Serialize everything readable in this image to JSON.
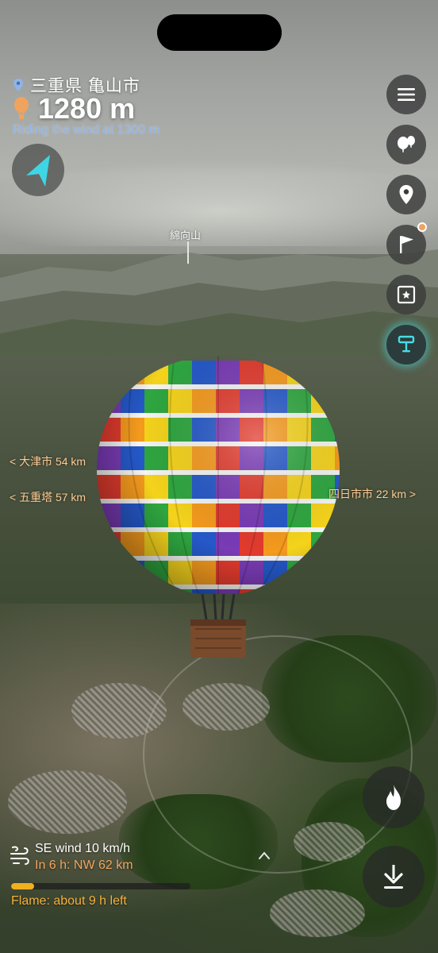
{
  "location": {
    "name": "三重県 亀山市"
  },
  "altitude": {
    "value": "1280 m"
  },
  "status": {
    "riding_text": "Riding the wind at 1300 m"
  },
  "map": {
    "peak_label": "綿向山"
  },
  "directions": {
    "left_1": "< 大津市 54 km",
    "left_2": "< 五重塔 57 km",
    "right_1": "四日市市 22 km >"
  },
  "wind": {
    "current": "SE wind 10 km/h",
    "forecast": "In 6 h: NW 62 km"
  },
  "fuel": {
    "level_fraction": 0.13,
    "label": "Flame: about 9 h left"
  },
  "colors": {
    "accent_cyan": "#46dce6",
    "orange": "#f0a35e",
    "fuel_bar": "#f0b020",
    "subtitle_blue": "#8fb4e8"
  },
  "icons": {
    "menu": "hamburger-menu-icon",
    "balloons": "balloons-icon",
    "pin": "map-pin-icon",
    "flag": "flag-icon",
    "photo": "photo-frame-icon",
    "anchor": "mooring-icon",
    "compass": "compass-arrow-icon",
    "flame": "flame-icon",
    "download": "download-arrow-icon",
    "wind": "wind-icon"
  }
}
